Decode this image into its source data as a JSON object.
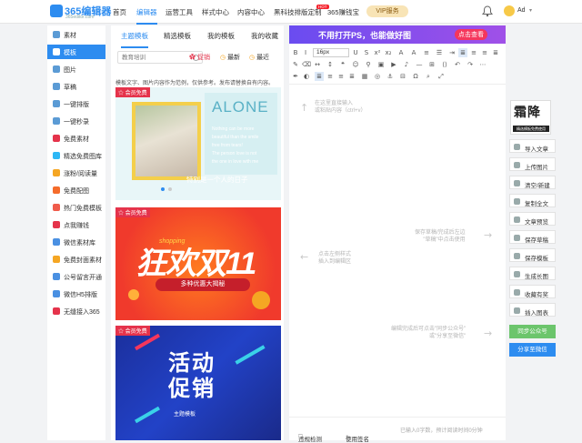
{
  "header": {
    "logo_name": "365编辑器",
    "logo_sub": "365editor.com",
    "nav": [
      "首页",
      "编辑器",
      "运营工具",
      "样式中心",
      "内容中心",
      "黑科技排版定制",
      "365赚钱宝"
    ],
    "hot_badge": "HOT",
    "vip_label": "VIP服务",
    "user": "Ad"
  },
  "sidebar": {
    "items": [
      {
        "label": "素材",
        "color": "#5b9bd5"
      },
      {
        "label": "模板",
        "color": "#ffffff"
      },
      {
        "label": "图片",
        "color": "#5b9bd5"
      },
      {
        "label": "草稿",
        "color": "#5b9bd5"
      },
      {
        "label": "一键排版",
        "color": "#5b9bd5"
      },
      {
        "label": "一键秒录",
        "color": "#5b9bd5"
      },
      {
        "label": "免费素材",
        "color": "#e5334b"
      },
      {
        "label": "精选免费图库",
        "color": "#2db7f5"
      },
      {
        "label": "涨粉/阅读量",
        "color": "#f5a623"
      },
      {
        "label": "免费配图",
        "color": "#f56c2b"
      },
      {
        "label": "热门免费模板",
        "color": "#f05b4b"
      },
      {
        "label": "点我赚钱",
        "color": "#e5334b"
      },
      {
        "label": "微信素材库",
        "color": "#4a90e2"
      },
      {
        "label": "免费封面素材",
        "color": "#f5a623"
      },
      {
        "label": "公号留言开通",
        "color": "#4a90e2"
      },
      {
        "label": "微信H5排版",
        "color": "#4a90e2"
      },
      {
        "label": "无缝接入365",
        "color": "#e5334b"
      }
    ]
  },
  "panel": {
    "tabs": [
      "主题模板",
      "精选模板",
      "我的模板",
      "我的收藏"
    ],
    "search_placeholder": "教育培训",
    "filters": [
      "促销",
      "最新",
      "最近"
    ],
    "notice": "模板文字、图片内容作为范例，仅供参考。发布请替换自有内容。",
    "badge": "会员免费",
    "tpl1": {
      "title": "ALONE",
      "poem": [
        "Nothing can be more",
        "beautiful than the smile",
        "free from tears!",
        "The person love is not",
        "the one in love with me"
      ],
      "caption": "特别是一个人的日子"
    },
    "tpl2": {
      "sub": "shopping",
      "title": "狂欢双11",
      "tag": "多种优惠大揭秘"
    },
    "tpl3": {
      "title_a": "活动",
      "title_b": "促销",
      "tag": "主题模板"
    }
  },
  "editor": {
    "banner": "不用打开PS，也能做好图",
    "banner_btn": "点击查看",
    "font_size": "16px",
    "hint_top": [
      "在这里直接输入",
      "或粘贴内容（ctrl+v）"
    ],
    "hint_left": [
      "点击左侧样式",
      "插入到编辑区"
    ],
    "hint_right": [
      "保存草稿/完成后左边",
      "\"草稿\"中点击使用"
    ],
    "hint_bottom": [
      "编辑完成后可点击\"同步公众号\"",
      "或\"分享至微信\""
    ],
    "footer_check": "违规检测",
    "footer_sign": "使用签名",
    "footer_count": "已输入0字数，预计阅读时间0分钟"
  },
  "rightpanel": {
    "qr_title": "霜降",
    "qr_sub": "精选模板免费使用",
    "actions": [
      "导入文章",
      "上传图片",
      "清空/新建",
      "复制全文",
      "文章预览",
      "保存草稿",
      "保存模板",
      "生成长图",
      "收藏有奖",
      "插入图表"
    ],
    "sync_btn": "同步公众号",
    "share_btn": "分享至微信",
    "sync_color": "#6cc56c",
    "share_color": "#2d8cf0"
  }
}
